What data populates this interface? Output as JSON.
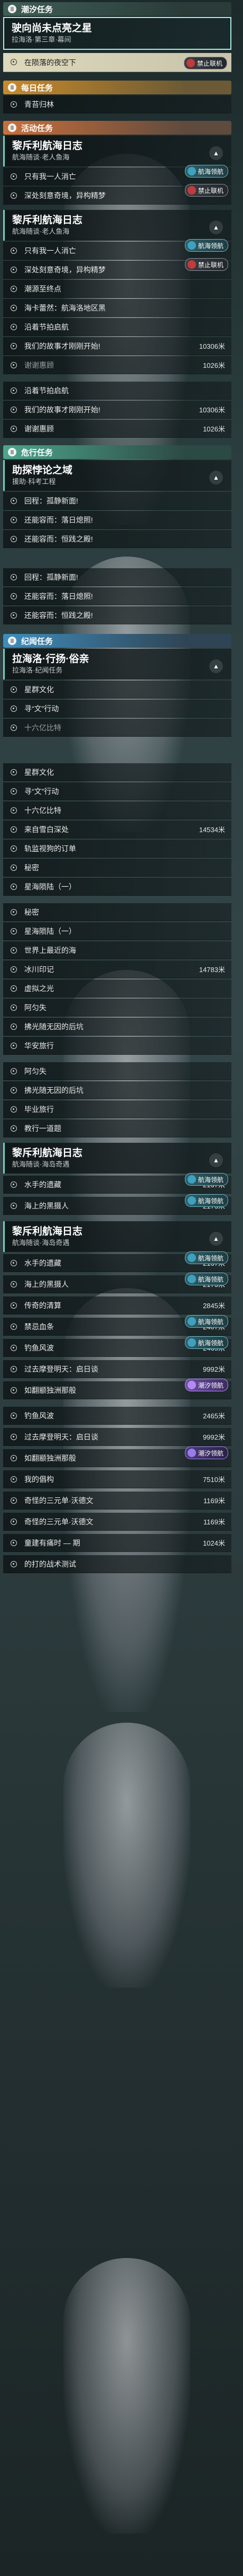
{
  "categories": {
    "tide": "潮汐任务",
    "daily": "每日任务",
    "event": "活动任务",
    "hunt": "危行任务",
    "record": "纪闻任务"
  },
  "badges": {
    "no_online": "禁止联机",
    "voyage": "航海领航",
    "tide_guide": "潮汐领航",
    "sub_guide": "潮汐领航"
  },
  "cards": {
    "tide_main": {
      "title": "驶向尚未点亮之星",
      "subtitle": "拉海洛·第三章·幕间"
    },
    "voyage1": {
      "title": "黎斥利航海日志",
      "subtitle": "航海随谈·老人鱼海"
    },
    "voyage2": {
      "title": "黎斥利航海日志",
      "subtitle": "航海随谈·老人鱼海"
    },
    "hunt": {
      "title": "助探悖论之域",
      "subtitle": "援助·科考工程"
    },
    "record1": {
      "title": "拉海洛·行扬·俗亲",
      "subtitle": "拉海洛·纪闻任务"
    },
    "voyage3": {
      "title": "黎斥利航海日志",
      "subtitle": "航海随谈·海岛奇遇"
    },
    "voyage4": {
      "title": "黎斥利航海日志",
      "subtitle": "航海随谈·海岛奇遇"
    }
  },
  "rows": {
    "r001": {
      "label": "在陨落的夜空下"
    },
    "r002": {
      "label": "青苔归林"
    },
    "r003": {
      "label": "只有我一人消亡"
    },
    "r004": {
      "label": "深处刻意奇境，异构精梦"
    },
    "r005": {
      "label": "只有我一人消亡"
    },
    "r006": {
      "label": "深处刻意奇境，异构精梦"
    },
    "r007": {
      "label": "潮源至终点"
    },
    "r008": {
      "label": "海卡蕾然：航海洛地区黑"
    },
    "r009": {
      "label": "沿着节拍启航"
    },
    "r010": {
      "label": "我们的故事才刚刚开始!",
      "dist": "10306米"
    },
    "r011": {
      "label": "谢谢惠顾",
      "dist": "1026米"
    },
    "r012": {
      "label": "沿着节拍启航"
    },
    "r013": {
      "label": "我们的故事才刚刚开始!",
      "dist": "10306米"
    },
    "r014": {
      "label": "谢谢惠顾",
      "dist": "1026米"
    },
    "r015": {
      "label": "回程：孤静新面!"
    },
    "r016": {
      "label": "还能容而：落日熄照!"
    },
    "r017": {
      "label": "还能容而：恒践之殿!"
    },
    "r018": {
      "label": "回程：孤静新面!"
    },
    "r019": {
      "label": "还能容而：落日熄照!"
    },
    "r020": {
      "label": "还能容而：恒践之殿!"
    },
    "r021": {
      "label": "星群文化"
    },
    "r022": {
      "label": "寻“文”行动"
    },
    "r023": {
      "label": "十六亿比特"
    },
    "r024": {
      "label": "星群文化"
    },
    "r025": {
      "label": "寻“文”行动"
    },
    "r026": {
      "label": "十六亿比特"
    },
    "r027": {
      "label": "来自雪白深处",
      "dist": "14534米"
    },
    "r028": {
      "label": "轨监视狗的订单"
    },
    "r029": {
      "label": "秘密"
    },
    "r030": {
      "label": "星海陨陆（一）"
    },
    "r031": {
      "label": "秘密"
    },
    "r032": {
      "label": "星海陨陆（一）"
    },
    "r033": {
      "label": "世界上最近的海"
    },
    "r034": {
      "label": "冰川印记",
      "dist": "14783米"
    },
    "r035": {
      "label": "虚拟之光"
    },
    "r036": {
      "label": "阿匀失"
    },
    "r037": {
      "label": "拂光随无因的后坑"
    },
    "r038": {
      "label": "华安旅行"
    },
    "r039": {
      "label": "阿匀失"
    },
    "r040": {
      "label": "拂光随无因的后坑"
    },
    "r041": {
      "label": "毕业旅行"
    },
    "r042": {
      "label": "教行一道题"
    },
    "r043": {
      "label": "水手的遗藏",
      "dist": "2167米"
    },
    "r044": {
      "label": "海上的黑摄人",
      "dist": "2173米"
    },
    "r045": {
      "label": "水手的遗藏",
      "dist": "2167米"
    },
    "r046": {
      "label": "海上的黑摄人",
      "dist": "2173米"
    },
    "r047": {
      "label": "传奇的清算",
      "dist": "2845米"
    },
    "r048": {
      "label": "禁忌血条",
      "dist": "2407米"
    },
    "r049": {
      "label": "钓鱼风波",
      "dist": "2465米"
    },
    "r050": {
      "label": "过去摩登明天：启日谈",
      "dist": "9992米"
    },
    "r051": {
      "label": "如翻颛独洲那般"
    },
    "r052": {
      "label": "钓鱼风波",
      "dist": "2465米"
    },
    "r053": {
      "label": "过去摩登明天：启日谈",
      "dist": "9992米"
    },
    "r054": {
      "label": "如翻颛独洲那般"
    },
    "r055": {
      "label": "我的倡构",
      "dist": "7510米"
    },
    "r056": {
      "label": "奇怪的三元单·沃德文",
      "dist": "1169米"
    },
    "r057": {
      "label": "奇怪的三元单·沃德文",
      "dist": "1169米"
    },
    "r058": {
      "label": "童建有痛时 — 期",
      "dist": "1024米"
    },
    "r059": {
      "label": "的打的战术测试"
    }
  }
}
